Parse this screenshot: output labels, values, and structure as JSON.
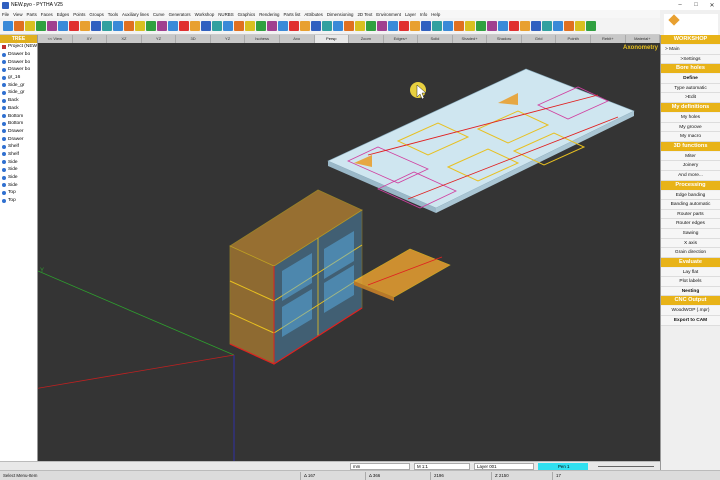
{
  "window": {
    "title": "NEW.pyo - PYTHA V25"
  },
  "menu": [
    "File",
    "View",
    "Parts",
    "Faces",
    "Edges",
    "Points",
    "Groups",
    "Tools",
    "Auxiliary lines",
    "Curve",
    "Generators",
    "Workshop",
    "NURBS",
    "Graphics",
    "Rendering",
    "Parts list",
    "Attributes",
    "Dimensioning",
    "2D Text",
    "Environment",
    "Layer",
    "Info",
    "Help"
  ],
  "viewbar": {
    "tabs": [
      "<< View",
      "XY",
      "XZ",
      "YZ",
      "3D",
      "YZ",
      "Isohess",
      "Axo",
      "Persp",
      "Zoom",
      "Edges+",
      "Solid",
      "Shaded+",
      "Shadow",
      "Grid",
      "Pointh",
      "Rebit+",
      "Material+"
    ],
    "active_index": 8
  },
  "tree": {
    "header": "TREE",
    "items": [
      "Project (NEW",
      "Drawer bo",
      "Drawer bo",
      "Drawer bo",
      "gr_16",
      "Side_gr",
      "Side_gr",
      "Back",
      "Back",
      "Bottom",
      "Bottom",
      "Drawer",
      "Drawer",
      "Shelf",
      "Shelf",
      "Side",
      "Side",
      "Side",
      "Side",
      "Top",
      "Top"
    ]
  },
  "canvas": {
    "view_label": "Axonometry",
    "axis_label_y": "Y"
  },
  "workshop": {
    "header": "WORKSHOP",
    "sections": [
      {
        "title": null,
        "items": [
          "> Main",
          ">Settings"
        ]
      },
      {
        "title": "Bore holes",
        "items": [
          "Define",
          "Type automatic",
          ">Edit"
        ]
      },
      {
        "title": "My definitions",
        "items": [
          "My holes",
          "My groove",
          "My macro"
        ]
      },
      {
        "title": "3D functions",
        "items": [
          "Miter",
          "Joinery",
          "And more..."
        ]
      },
      {
        "title": "Processing",
        "items": [
          "Edge banding",
          "Banding automatic",
          "Router parts",
          "Router edges",
          "Sawing",
          "X axis",
          "Grain direction"
        ]
      },
      {
        "title": "Evaluate",
        "items": [
          "Lay flat",
          "Plot labels",
          "Nesting"
        ]
      },
      {
        "title": "CNC Output",
        "items": [
          "WoodWOP (.mpr)",
          "Export to CAM"
        ]
      }
    ]
  },
  "status": {
    "unit": "mm",
    "scale": "M 1:1",
    "layer": "Layer 001",
    "pen": "Pen 1"
  },
  "coords": {
    "hint": "Select Menu-Item",
    "dx": "Δ 167",
    "dy": "Δ 366",
    "x": "2196",
    "z": "Z 2150",
    "n": "17"
  },
  "colors": {
    "accent": "#e8b318",
    "canvas_bg": "#343434",
    "wood": "#e8a030",
    "glass": "#5ab0e8",
    "sheet": "#cfe6f0",
    "pen_cyan": "#30e0f0"
  }
}
